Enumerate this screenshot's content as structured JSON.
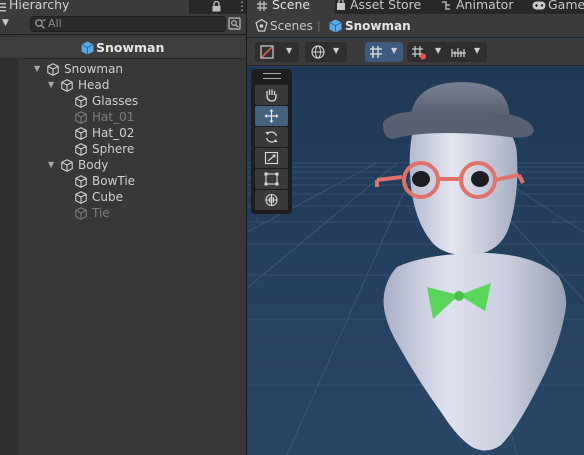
{
  "hierarchy": {
    "tab_label": "Hierarchy",
    "search_placeholder": "All",
    "scene_name": "Snowman",
    "tree": [
      {
        "label": "Snowman",
        "depth": 0,
        "fold": "expanded",
        "active": true
      },
      {
        "label": "Head",
        "depth": 1,
        "fold": "expanded",
        "active": true
      },
      {
        "label": "Glasses",
        "depth": 2,
        "fold": "none",
        "active": true
      },
      {
        "label": "Hat_01",
        "depth": 2,
        "fold": "none",
        "active": false
      },
      {
        "label": "Hat_02",
        "depth": 2,
        "fold": "none",
        "active": true
      },
      {
        "label": "Sphere",
        "depth": 2,
        "fold": "none",
        "active": true
      },
      {
        "label": "Body",
        "depth": 1,
        "fold": "expanded",
        "active": true
      },
      {
        "label": "BowTie",
        "depth": 2,
        "fold": "none",
        "active": true
      },
      {
        "label": "Cube",
        "depth": 2,
        "fold": "none",
        "active": true
      },
      {
        "label": "Tie",
        "depth": 2,
        "fold": "none",
        "active": false
      }
    ]
  },
  "scene_view": {
    "tabs": [
      {
        "label": "Scene",
        "icon": "grid-icon",
        "active": true
      },
      {
        "label": "Asset Store",
        "icon": "store-icon",
        "active": false
      },
      {
        "label": "Animator",
        "icon": "animator-icon",
        "active": false
      },
      {
        "label": "Game",
        "icon": "gamepad-icon",
        "active": false
      }
    ],
    "breadcrumb": {
      "root": "Scenes",
      "current": "Snowman"
    },
    "toolbar_icons": [
      "draw-mode-icon",
      "globe-icon",
      "grid-snap-icon",
      "increment-snap-icon",
      "ruler-icon"
    ],
    "tools": [
      "hand-icon",
      "move-icon",
      "rotate-icon",
      "scale-icon",
      "rect-icon",
      "transform-icon"
    ],
    "selected_tool": "move-icon"
  },
  "colors": {
    "accent_blue": "#3c5b7e",
    "bowtie_green": "#5ad65a",
    "glasses_red": "#e0726a",
    "inactive_text": "#7a7a7a",
    "sky": "#26405e"
  }
}
